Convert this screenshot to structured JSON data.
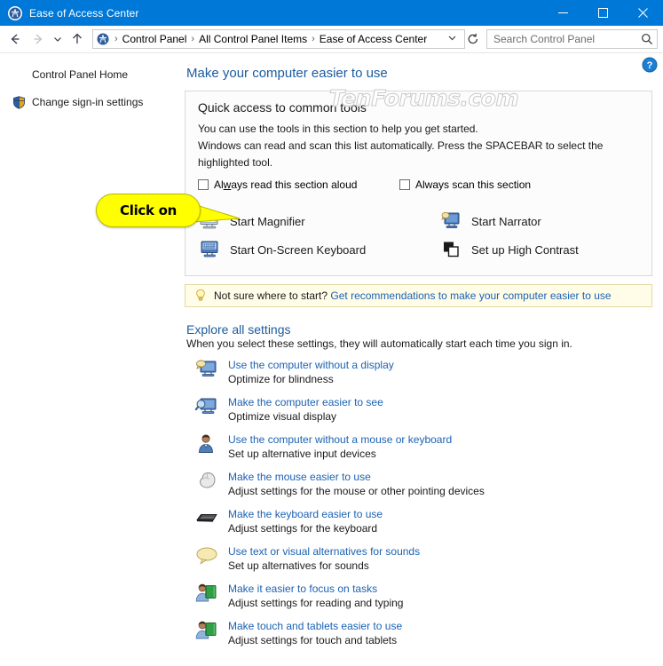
{
  "window": {
    "title": "Ease of Access Center",
    "icon": "ease-of-access-icon",
    "controls": {
      "minimize": "Minimize",
      "maximize": "Maximize",
      "close": "Close"
    }
  },
  "nav": {
    "back": "Back",
    "forward": "Forward",
    "recent": "Recent locations",
    "up": "Up",
    "refresh": "Refresh",
    "dropdown": "Previous locations",
    "breadcrumbs": [
      {
        "label": "Control Panel"
      },
      {
        "label": "All Control Panel Items"
      },
      {
        "label": "Ease of Access Center"
      }
    ],
    "separator": "›"
  },
  "search": {
    "placeholder": "Search Control Panel",
    "icon": "search-icon"
  },
  "sidebar": {
    "items": [
      {
        "label": "Control Panel Home",
        "icon": null
      },
      {
        "label": "Change sign-in settings",
        "icon": "shield-icon"
      }
    ]
  },
  "help": {
    "label": "Help",
    "icon": "help-icon"
  },
  "main": {
    "heading": "Make your computer easier to use",
    "watermark": "TenForums.com",
    "quick_access": {
      "heading": "Quick access to common tools",
      "line1": "You can use the tools in this section to help you get started.",
      "line2": "Windows can read and scan this list automatically.  Press the SPACEBAR to select the highlighted tool.",
      "checkboxes": [
        {
          "label_pre": "Al",
          "label_acc": "w",
          "label_post": "ays read this section aloud",
          "checked": false
        },
        {
          "label_pre": "",
          "label_acc": "",
          "label_post": "Always scan this section",
          "checked": false
        }
      ],
      "tools": [
        {
          "label": "Start Magnifier",
          "icon": "magnifier-icon"
        },
        {
          "label": "Start Narrator",
          "icon": "narrator-icon"
        },
        {
          "label": "Start On-Screen Keyboard",
          "icon": "on-screen-keyboard-icon"
        },
        {
          "label": "Set up High Contrast",
          "icon": "high-contrast-icon"
        }
      ]
    },
    "recommendation": {
      "icon": "lightbulb-icon",
      "text": "Not sure where to start?",
      "link": "Get recommendations to make your computer easier to use"
    },
    "explore": {
      "heading": "Explore all settings",
      "subheading": "When you select these settings, they will automatically start each time you sign in.",
      "items": [
        {
          "link": "Use the computer without a display",
          "desc": "Optimize for blindness",
          "icon": "display-speech-icon"
        },
        {
          "link": "Make the computer easier to see",
          "desc": "Optimize visual display",
          "icon": "display-magnify-icon"
        },
        {
          "link": "Use the computer without a mouse or keyboard",
          "desc": "Set up alternative input devices",
          "icon": "person-icon"
        },
        {
          "link": "Make the mouse easier to use",
          "desc": "Adjust settings for the mouse or other pointing devices",
          "icon": "mouse-icon"
        },
        {
          "link": "Make the keyboard easier to use",
          "desc": "Adjust settings for the keyboard",
          "icon": "keyboard-icon"
        },
        {
          "link": "Use text or visual alternatives for sounds",
          "desc": "Set up alternatives for sounds",
          "icon": "speech-bubble-icon"
        },
        {
          "link": "Make it easier to focus on tasks",
          "desc": "Adjust settings for reading and typing",
          "icon": "person-book-icon"
        },
        {
          "link": "Make touch and tablets easier to use",
          "desc": "Adjust settings for touch and tablets",
          "icon": "person-book-icon"
        }
      ]
    }
  },
  "callout": {
    "text": "Click on"
  },
  "colors": {
    "titlebar": "#0078d7",
    "heading": "#1b5b9e",
    "link": "#1b62b3",
    "callout": "#ffff00",
    "tip_background": "#fffce8"
  }
}
